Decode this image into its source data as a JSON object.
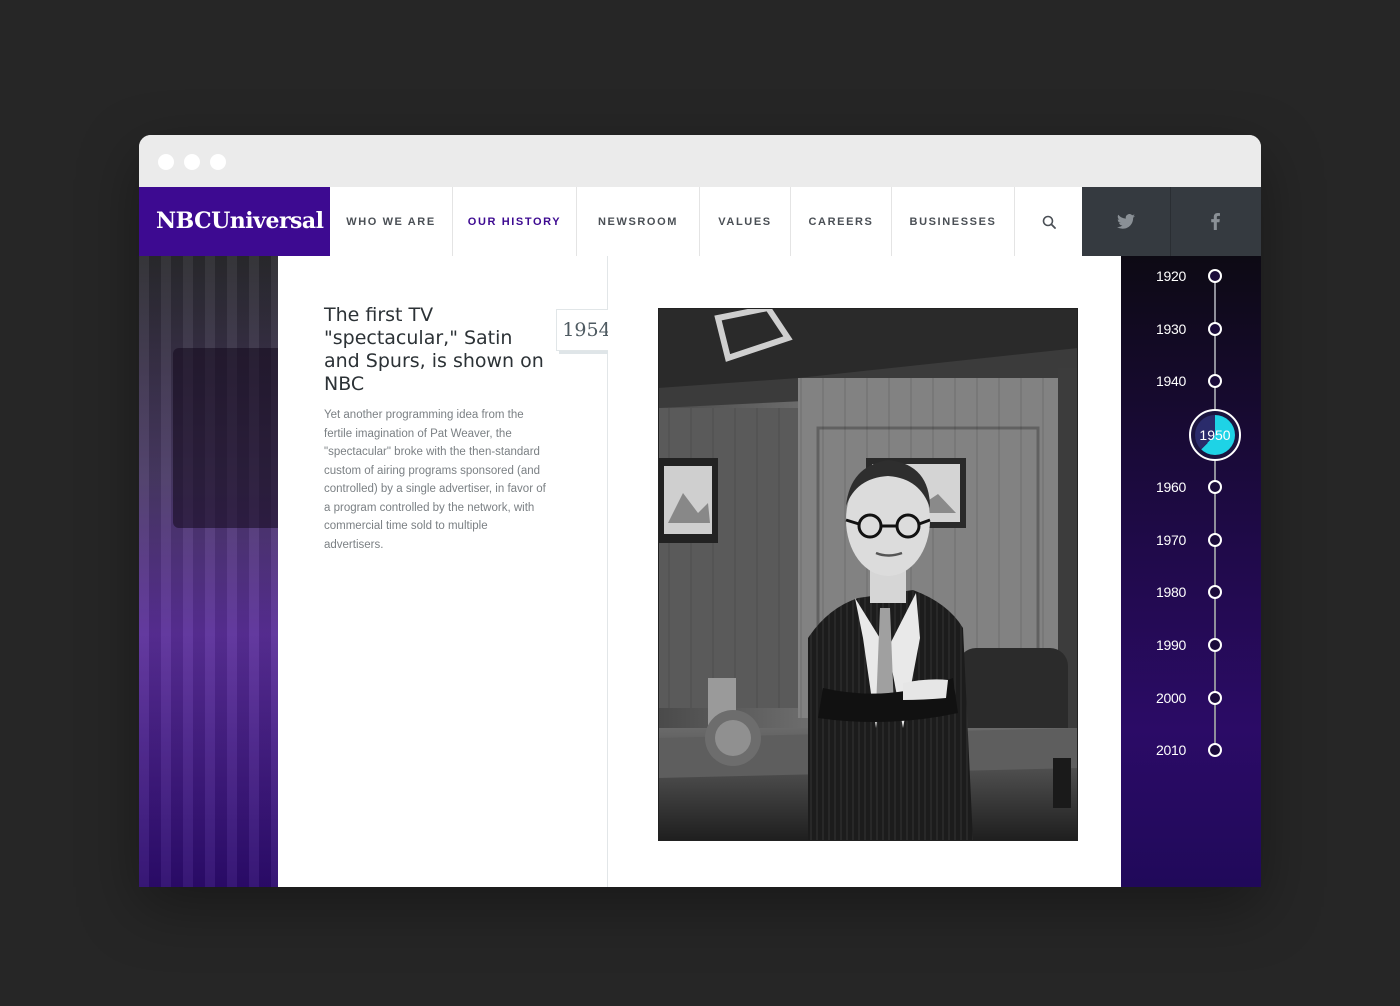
{
  "brand": {
    "name": "NBCUniversal"
  },
  "nav": {
    "items": [
      {
        "label": "WHO WE ARE",
        "active": false
      },
      {
        "label": "OUR HISTORY",
        "active": true
      },
      {
        "label": "NEWSROOM",
        "active": false
      },
      {
        "label": "VALUES",
        "active": false
      },
      {
        "label": "CAREERS",
        "active": false
      },
      {
        "label": "BUSINESSES",
        "active": false
      }
    ],
    "search_icon": "search-icon",
    "social": [
      "twitter-icon",
      "facebook-icon"
    ]
  },
  "article": {
    "year": "1954",
    "headline": "The first TV \"spectacular,\" Satin and Spurs, is shown on NBC",
    "body": "Yet another programming idea from the fertile imagination of Pat Weaver, the \"spectacular\" broke with the then-standard custom of airing programs sponsored (and controlled) by a single advertiser, in favor of a program controlled by the network, with commercial time sold to multiple advertisers."
  },
  "timeline": {
    "decades": [
      "1920",
      "1930",
      "1940",
      "1950",
      "1960",
      "1970",
      "1980",
      "1990",
      "2000",
      "2010"
    ],
    "active": "1950",
    "active_progress": 0.62
  },
  "colors": {
    "brand_purple": "#3d0a91",
    "accent_cyan": "#1ed3e6",
    "social_bar": "#353a40"
  }
}
